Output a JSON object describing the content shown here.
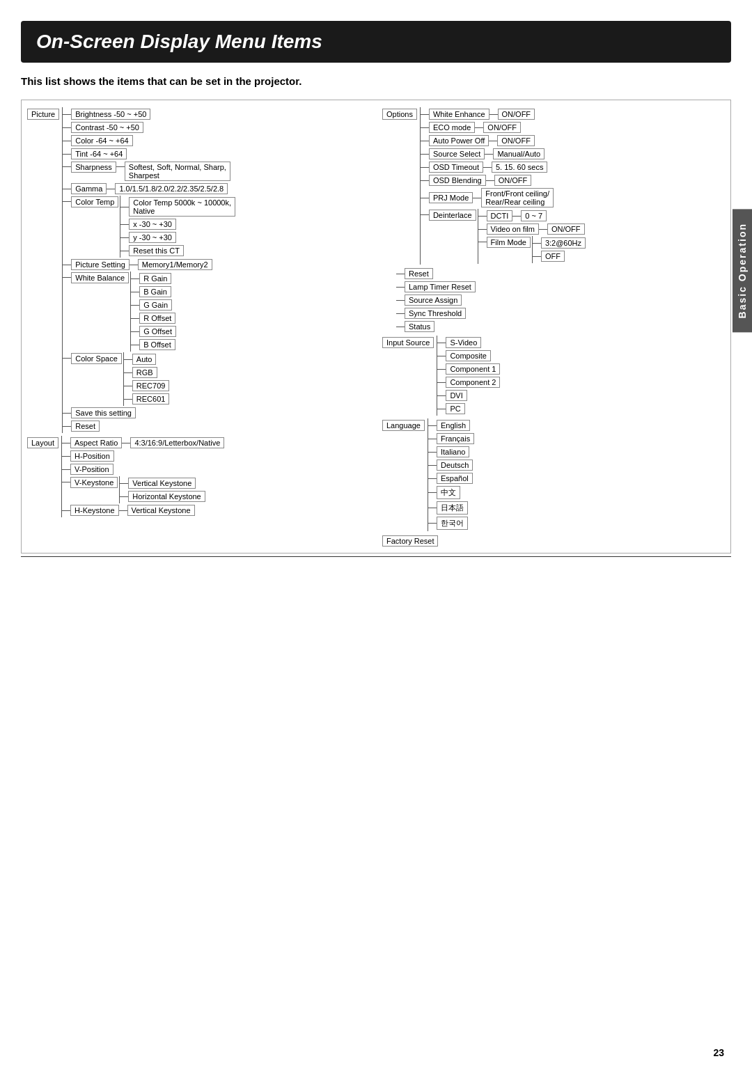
{
  "page": {
    "title": "On-Screen Display Menu Items",
    "subtitle": "This list shows the items that can be set in the projector.",
    "page_number": "23",
    "sidebar_label": "Basic Operation"
  },
  "left_tree": {
    "root": "Picture",
    "items": [
      {
        "label": "Brightness  -50 ~ +50",
        "children": []
      },
      {
        "label": "Contrast    -50 ~ +50",
        "children": []
      },
      {
        "label": "Color       -64 ~ +64",
        "children": []
      },
      {
        "label": "Tint        -64 ~ +64",
        "children": []
      },
      {
        "label": "Sharpness",
        "children": [
          "Softest, Soft, Normal, Sharp, Sharpest"
        ]
      },
      {
        "label": "Gamma",
        "children": [
          "1.0/1.5/1.8/2.0/2.2/2.35/2.5/2.8"
        ]
      },
      {
        "label": "Color Temp",
        "children": [
          "Color Temp 5000k ~ 10000k, Native",
          "x    -30 ~ +30",
          "y    -30 ~ +30",
          "Reset this CT"
        ]
      },
      {
        "label": "Picture Setting",
        "children": [
          "Memory1/Memory2"
        ]
      },
      {
        "label": "White Balance",
        "children": [
          "R Gain",
          "B Gain",
          "G Gain",
          "R Offset",
          "G Offset",
          "B Offset"
        ]
      },
      {
        "label": "Color Space",
        "children": [
          "Auto",
          "RGB",
          "REC709",
          "REC601"
        ]
      },
      {
        "label": "Save this setting",
        "children": []
      },
      {
        "label": "Reset",
        "children": []
      }
    ]
  },
  "layout_tree": {
    "root": "Layout",
    "items": [
      {
        "label": "Aspect Ratio",
        "children": [
          "4:3/16:9/Letterbox/Native"
        ]
      },
      {
        "label": "H-Position",
        "children": []
      },
      {
        "label": "V-Position",
        "children": []
      },
      {
        "label": "V-Keystone",
        "children": [
          "Vertical Keystone",
          "Horizontal Keystone"
        ]
      },
      {
        "label": "H-Keystone",
        "children": [
          "Vertical Keystone"
        ]
      }
    ]
  },
  "right_tree": {
    "options_root": "Options",
    "options_items": [
      {
        "label": "White Enhance",
        "children": [
          "ON/OFF"
        ]
      },
      {
        "label": "ECO mode",
        "children": [
          "ON/OFF"
        ]
      },
      {
        "label": "Auto Power Off",
        "children": [
          "ON/OFF"
        ]
      },
      {
        "label": "Source Select",
        "children": [
          "Manual/Auto"
        ]
      },
      {
        "label": "OSD Timeout",
        "children": [
          "5. 15. 60 secs"
        ]
      },
      {
        "label": "OSD Blending",
        "children": [
          "ON/OFF"
        ]
      },
      {
        "label": "PRJ Mode",
        "children": [
          "Front/Front ceiling/ Rear/Rear ceiling"
        ]
      },
      {
        "label": "Deinterlace",
        "children": [
          {
            "label": "DCTI",
            "children": [
              "0 ~ 7"
            ]
          },
          {
            "label": "Video on film",
            "children": [
              "ON/OFF"
            ]
          },
          {
            "label": "Film Mode",
            "children": [
              "3:2@60Hz",
              "OFF"
            ]
          }
        ]
      }
    ],
    "other_items": [
      {
        "label": "Reset",
        "children": []
      },
      {
        "label": "Lamp Timer Reset",
        "children": []
      },
      {
        "label": "Source Assign",
        "children": []
      },
      {
        "label": "Sync Threshold",
        "children": []
      },
      {
        "label": "Status",
        "children": []
      }
    ],
    "input_source_root": "Input Source",
    "input_source_items": [
      "S-Video",
      "Composite",
      "Component 1",
      "Component 2",
      "DVI",
      "PC"
    ],
    "language_root": "Language",
    "language_items": [
      "English",
      "Français",
      "Italiano",
      "Deutsch",
      "Español",
      "中文",
      "日本語",
      "한국어"
    ],
    "factory_reset": "Factory Reset"
  }
}
